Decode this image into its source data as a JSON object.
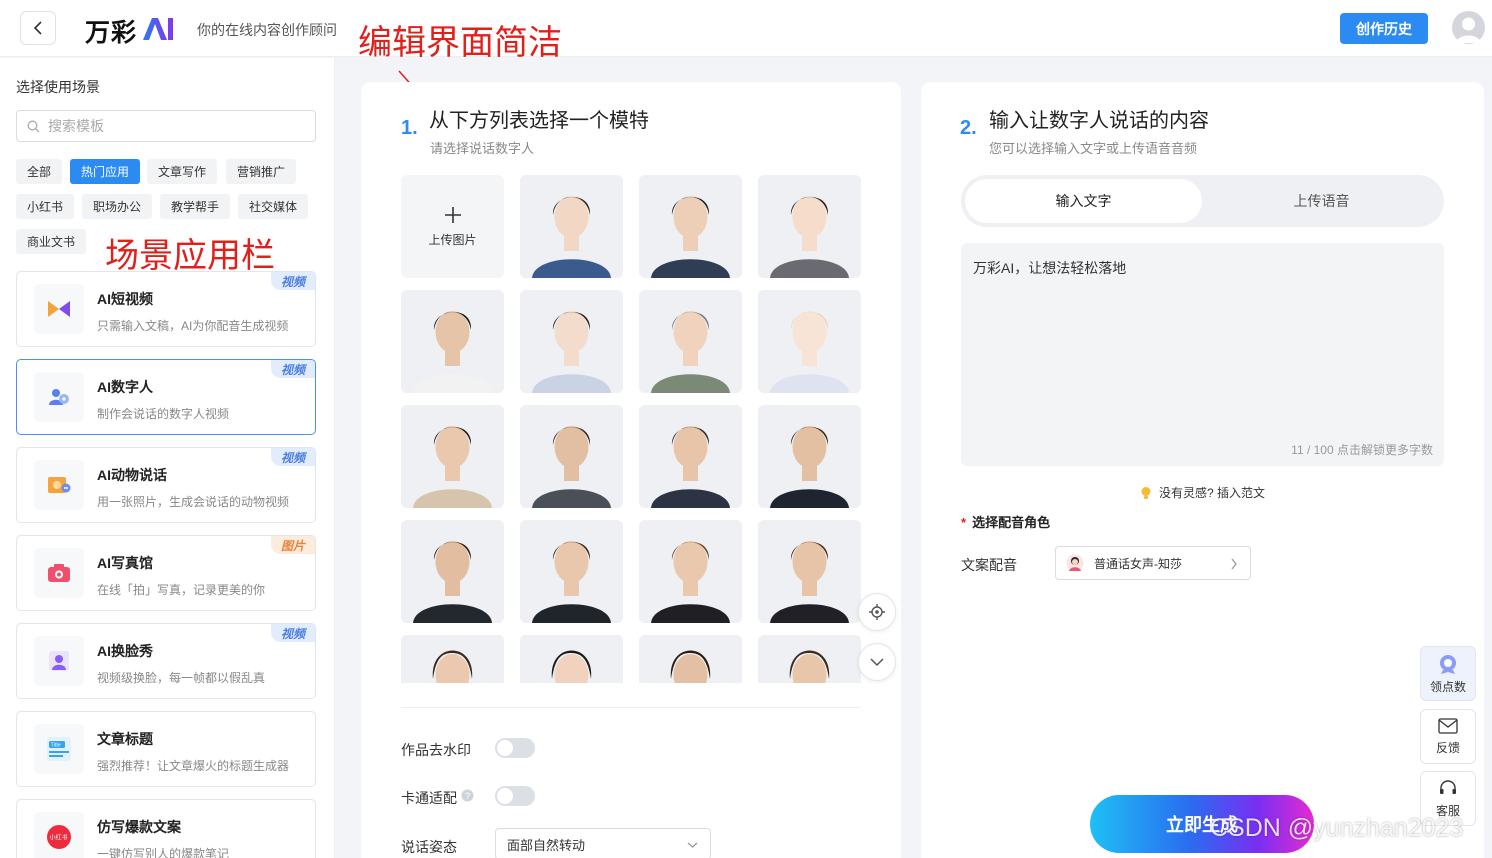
{
  "header": {
    "logo_text": "万彩",
    "logo_ai": "AI",
    "tagline": "你的在线内容创作顾问",
    "annotation": "编辑界面简洁",
    "history_button": "创作历史"
  },
  "sidebar": {
    "title": "选择使用场景",
    "search_placeholder": "搜索模板",
    "tags": [
      "全部",
      "热门应用",
      "文章写作",
      "营销推广",
      "小红书",
      "职场办公",
      "教学帮手",
      "社交媒体",
      "商业文书"
    ],
    "active_tag": "热门应用",
    "annotation": "场景应用栏",
    "cards": [
      {
        "title": "AI短视频",
        "desc": "只需输入文稿，AI为你配音生成视频",
        "badge": "视频"
      },
      {
        "title": "AI数字人",
        "desc": "制作会说话的数字人视频",
        "badge": "视频"
      },
      {
        "title": "AI动物说话",
        "desc": "用一张照片，生成会说话的动物视频",
        "badge": "视频"
      },
      {
        "title": "AI写真馆",
        "desc": "在线「拍」写真，记录更美的你",
        "badge": "图片"
      },
      {
        "title": "AI换脸秀",
        "desc": "视频级换脸，每一帧都以假乱真",
        "badge": "视频"
      },
      {
        "title": "文章标题",
        "desc": "强烈推荐！让文章爆火的标题生成器",
        "badge": ""
      },
      {
        "title": "仿写爆款文案",
        "desc": "一键仿写别人的爆款笔记",
        "badge": ""
      }
    ],
    "icon_labels": {
      "title_icon": "Title",
      "xhs_icon": "小红书"
    }
  },
  "step1": {
    "num": "1.",
    "title": "从下方列表选择一个模特",
    "subtitle": "请选择说话数字人",
    "upload_label": "上传图片",
    "watermark_label": "作品去水印",
    "cartoon_label": "卡通适配",
    "pose_label": "说话姿态",
    "pose_value": "面部自然转动"
  },
  "step2": {
    "num": "2.",
    "title": "输入让数字人说话的内容",
    "subtitle": "您可以选择输入文字或上传语音音频",
    "tab_text": "输入文字",
    "tab_voice": "上传语音",
    "text_value": "万彩AI，让想法轻松落地",
    "count": "11 / 100",
    "unlock": "点击解锁更多字数",
    "inspire_q": "没有灵感?",
    "inspire_link": "插入范文",
    "voice_role_title": "选择配音角色",
    "voice_label": "文案配音",
    "voice_value": "普通话女声-知莎",
    "generate": "立即生成"
  },
  "float_side": {
    "points": "领点数",
    "feedback": "反馈",
    "service": "客服"
  },
  "watermark_text": "CSDN @yunzhan2023",
  "colors": {
    "accent": "#2c8bf2",
    "annotation": "#e0201a"
  }
}
